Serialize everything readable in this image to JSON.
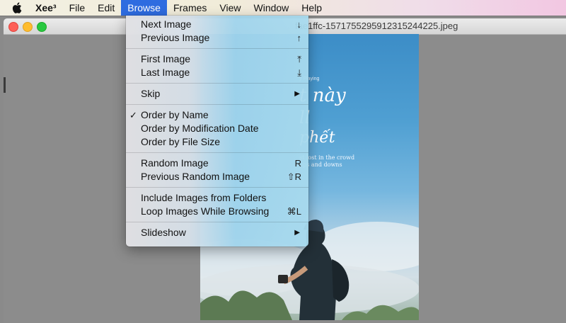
{
  "menubar": {
    "apple_icon": "apple-logo-icon",
    "app_name": "Xee³",
    "items": [
      "File",
      "Edit",
      "Browse",
      "Frames",
      "View",
      "Window",
      "Help"
    ],
    "active": "Browse"
  },
  "window": {
    "title": "fae1ffc-1571755295912315244225.jpeg"
  },
  "photo": {
    "now_playing": "y Playing",
    "song_line1": "t này",
    "song_line2": "ll",
    "song_line3": "phết",
    "lyric1": "st lost in the crowd",
    "lyric2": "ups and downs"
  },
  "browse_menu": {
    "groups": [
      [
        {
          "label": "Next Image",
          "shortcut": "↓"
        },
        {
          "label": "Previous Image",
          "shortcut": "↑"
        }
      ],
      [
        {
          "label": "First Image",
          "shortcut": "⤒"
        },
        {
          "label": "Last Image",
          "shortcut": "⤓"
        }
      ],
      [
        {
          "label": "Skip",
          "submenu": "▶"
        }
      ],
      [
        {
          "label": "Order by Name",
          "checked": "✓"
        },
        {
          "label": "Order by Modification Date"
        },
        {
          "label": "Order by File Size"
        }
      ],
      [
        {
          "label": "Random Image",
          "shortcut": "R"
        },
        {
          "label": "Previous Random Image",
          "shortcut": "⇧R"
        }
      ],
      [
        {
          "label": "Include Images from Folders"
        },
        {
          "label": "Loop Images While Browsing",
          "shortcut": "⌘L"
        }
      ],
      [
        {
          "label": "Slideshow",
          "submenu": "▶"
        }
      ]
    ]
  }
}
